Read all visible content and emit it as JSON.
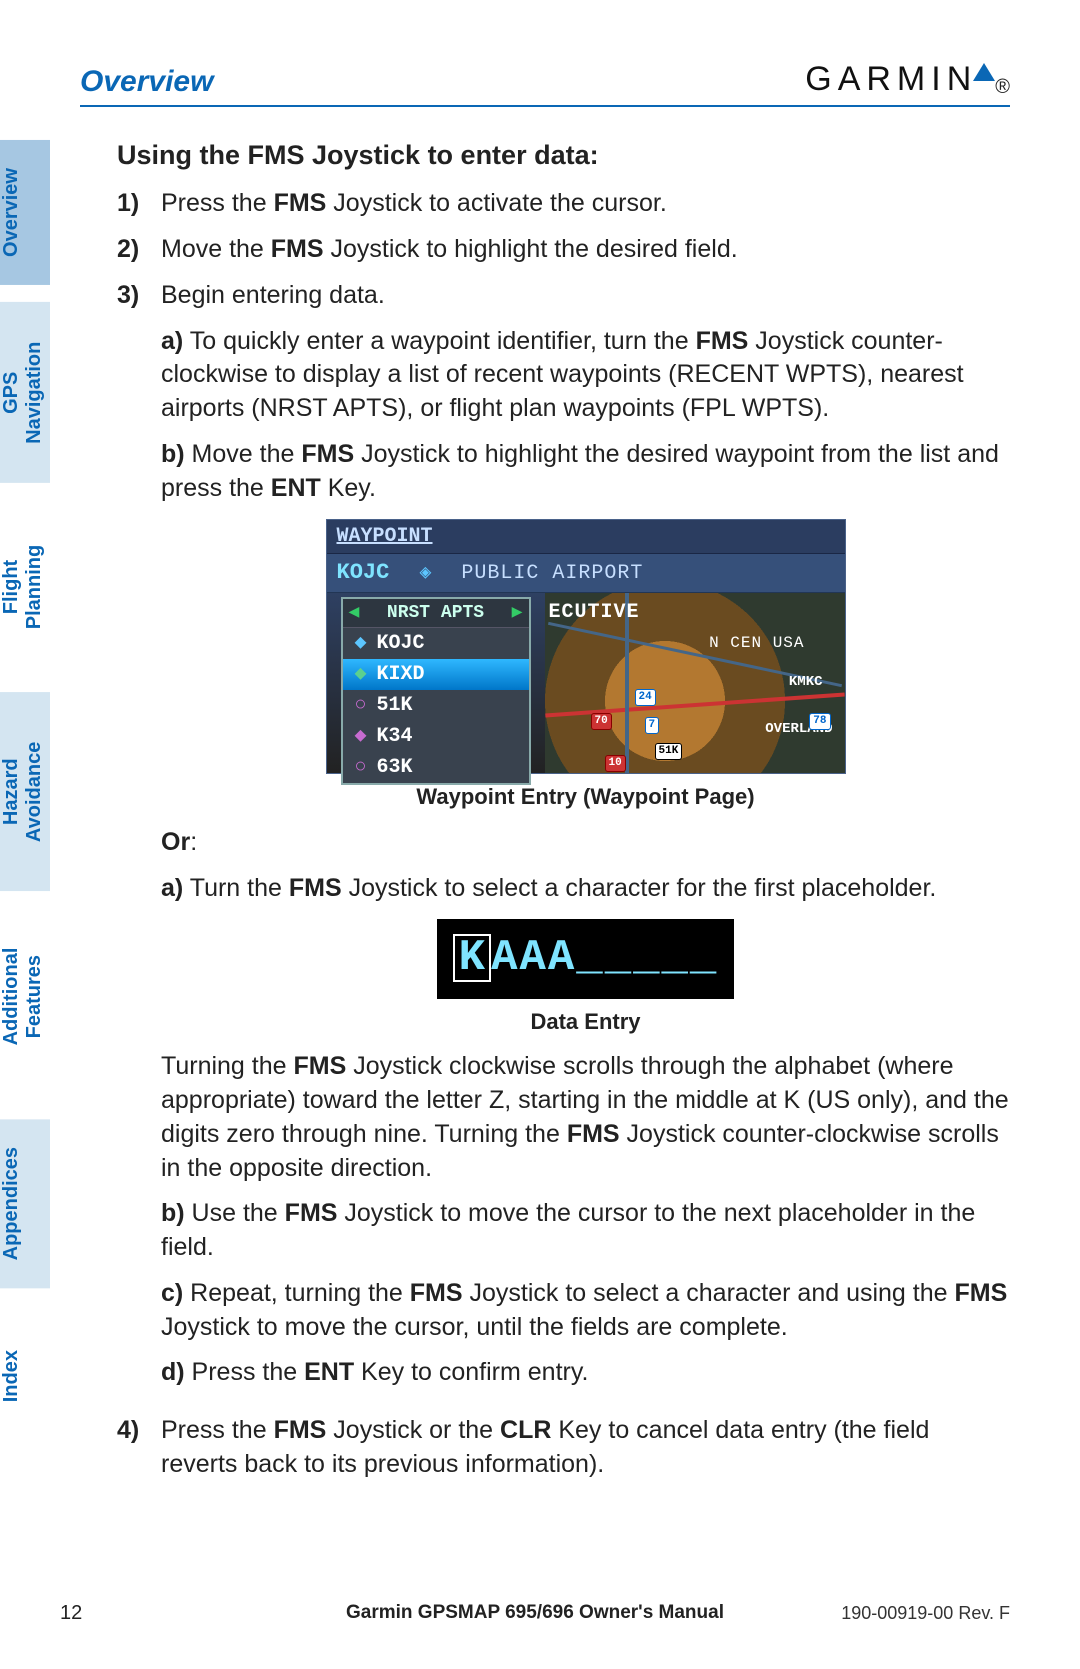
{
  "header": {
    "section": "Overview",
    "brand": "GARMIN"
  },
  "sidebar": {
    "tabs": [
      {
        "label": "Overview",
        "state": "active"
      },
      {
        "label": "GPS Navigation",
        "state": "inactive"
      },
      {
        "label": "Flight Planning",
        "state": "plain"
      },
      {
        "label": "Hazard Avoidance",
        "state": "inactive"
      },
      {
        "label": "Additional Features",
        "state": "plain"
      },
      {
        "label": "Appendices",
        "state": "inactive"
      },
      {
        "label": "Index",
        "state": "plain"
      }
    ]
  },
  "content": {
    "subheading": "Using the FMS Joystick to enter data:",
    "steps": {
      "s1": {
        "num": "1)",
        "pre": "Press the ",
        "b1": "FMS",
        "post": " Joystick to activate the cursor."
      },
      "s2": {
        "num": "2)",
        "pre": "Move the ",
        "b1": "FMS",
        "post": " Joystick to highlight the desired field."
      },
      "s3": {
        "num": "3)",
        "text": "Begin entering data.",
        "a_label": "a)",
        "a_pre": "  To quickly enter a waypoint identifier, turn the ",
        "a_b": "FMS",
        "a_post": " Joystick counter-clockwise to display a list of recent waypoints (RECENT WPTS), nearest airports (NRST APTS), or flight plan waypoints (FPL WPTS).",
        "b_label": "b)",
        "b_pre": "  Move the ",
        "b_b1": "FMS",
        "b_mid": " Joystick to highlight the desired waypoint from the list and press the ",
        "b_b2": "ENT",
        "b_post": " Key.",
        "figcap1": "Waypoint Entry (Waypoint Page)",
        "or": "Or",
        "or_colon": ":",
        "alt_a_label": "a)",
        "alt_a_pre": "  Turn the ",
        "alt_a_b": "FMS",
        "alt_a_post": " Joystick to select a character for the first placeholder.",
        "figcap2": "Data Entry",
        "para_pre": "Turning the ",
        "para_b1": "FMS",
        "para_mid": " Joystick clockwise scrolls through the alphabet (where appropriate) toward the letter Z, starting in the middle at K (US only), and the digits zero through nine.  Turning the ",
        "para_b2": "FMS",
        "para_post": " Joystick counter-clockwise scrolls in the opposite direction.",
        "alt_b_label": "b)",
        "alt_b_pre": "  Use the ",
        "alt_b_b": "FMS",
        "alt_b_post": " Joystick to move the cursor to the next placeholder in the field.",
        "alt_c_label": "c)",
        "alt_c_pre": "  Repeat, turning the ",
        "alt_c_b1": "FMS",
        "alt_c_mid": " Joystick to select a character and using the ",
        "alt_c_b2": "FMS",
        "alt_c_post": " Joystick to move the cursor, until the fields are complete.",
        "alt_d_label": "d)",
        "alt_d_pre": "  Press the ",
        "alt_d_b": "ENT",
        "alt_d_post": " Key to confirm entry."
      },
      "s4": {
        "num": "4)",
        "pre": "Press the ",
        "b1": "FMS",
        "mid": " Joystick or the ",
        "b2": "CLR",
        "post": " Key to cancel data entry (the field reverts back to its previous information)."
      }
    }
  },
  "waypoint_fig": {
    "title": "WAYPOINT",
    "id": "KOJC",
    "type": "PUBLIC AIRPORT",
    "list_header": "NRST APTS",
    "list_tri_l": "◀",
    "list_tri_r": "▶",
    "items": [
      {
        "sym": "◆",
        "symclass": "cyan",
        "code": "KOJC"
      },
      {
        "sym": "◆",
        "symclass": "grn",
        "code": "KIXD",
        "selected": true
      },
      {
        "sym": "○",
        "symclass": "mag",
        "code": "51K"
      },
      {
        "sym": "◆",
        "symclass": "mag",
        "code": "K34"
      },
      {
        "sym": "○",
        "symclass": "mag",
        "code": "63K"
      }
    ],
    "map": {
      "ecutive": "ECUTIVE",
      "region": "N CEN USA",
      "city1": "KMKC",
      "city2": "OVERLAND",
      "hwy70": "70",
      "hwy24": "24",
      "hwy7": "7",
      "hwy51": "51K",
      "hwy10": "10",
      "hwy78": "78"
    }
  },
  "entry_fig": {
    "cursor": "K",
    "rest": "AAA_____"
  },
  "footer": {
    "page": "12",
    "title": "Garmin GPSMAP 695/696 Owner's Manual",
    "rev": "190-00919-00  Rev. F"
  }
}
